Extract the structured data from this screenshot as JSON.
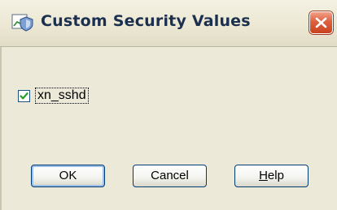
{
  "window": {
    "title": "Custom Security Values"
  },
  "options": {
    "items": [
      {
        "label": "xn_sshd",
        "checked": true
      }
    ]
  },
  "buttons": {
    "ok": "OK",
    "cancel": "Cancel",
    "help_first": "H",
    "help_rest": "elp"
  },
  "icons": {
    "app": "shield-chart-icon",
    "close": "close-icon",
    "check": "checkmark-icon"
  },
  "colors": {
    "close_button": "#e0603d",
    "checkmark": "#21a121",
    "title_text": "#1b2f4f"
  }
}
